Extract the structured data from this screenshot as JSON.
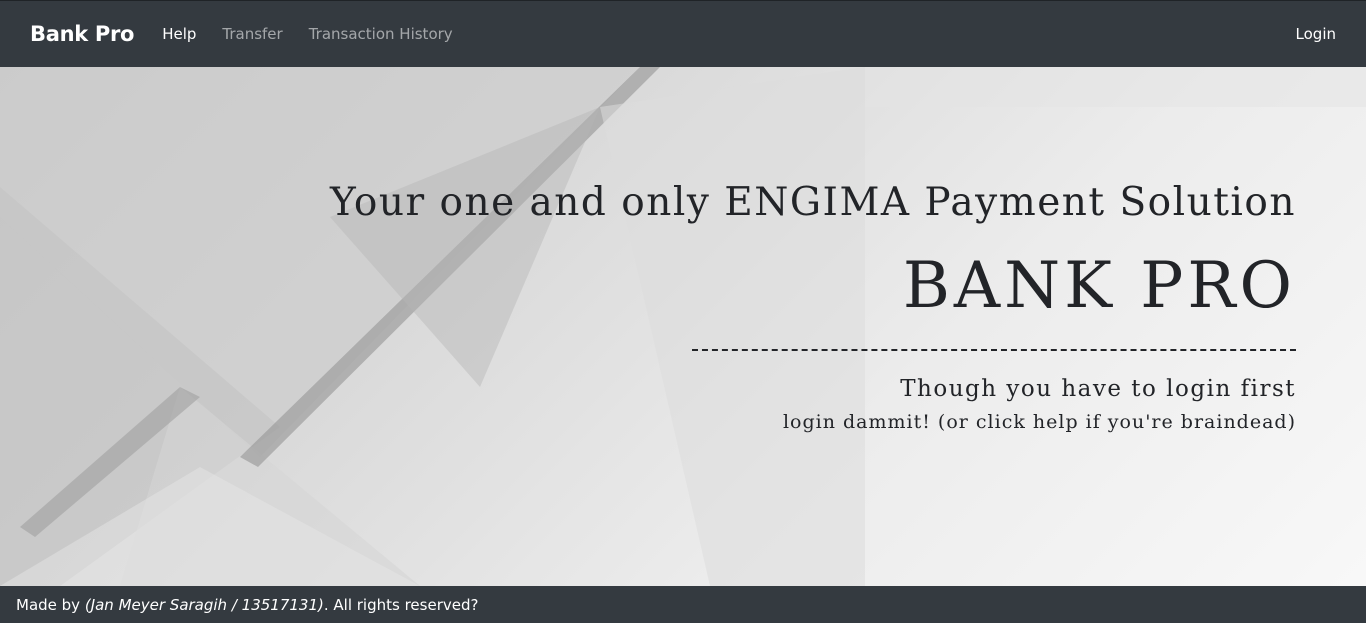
{
  "navbar": {
    "brand": "Bank Pro",
    "links": [
      {
        "label": "Help"
      },
      {
        "label": "Transfer"
      },
      {
        "label": "Transaction History"
      }
    ],
    "login": "Login"
  },
  "hero": {
    "tagline": "Your one and only ENGIMA Payment Solution",
    "title": "BANK PRO",
    "subtitle": "Though you have to login first",
    "note": "login dammit! (or click help if you're braindead)"
  },
  "footer": {
    "prefix": "Made by ",
    "author": "(Jan Meyer Saragih / 13517131)",
    "suffix": ". All rights reserved?"
  },
  "colors": {
    "navbar_bg": "#343a40",
    "text_dark": "#222428"
  }
}
